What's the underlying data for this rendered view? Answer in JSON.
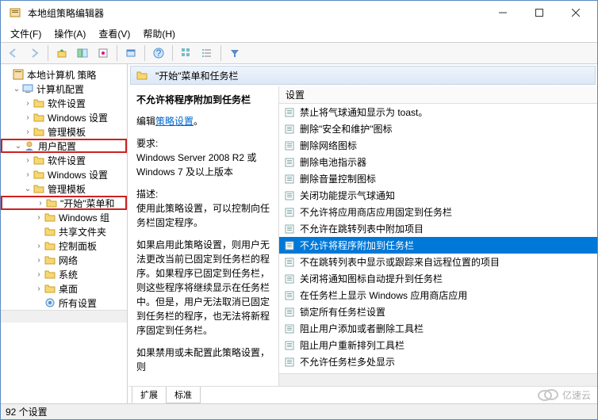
{
  "window": {
    "title": "本地组策略编辑器"
  },
  "menu": {
    "file": "文件(F)",
    "action": "操作(A)",
    "view": "查看(V)",
    "help": "帮助(H)"
  },
  "tree": {
    "root": "本地计算机 策略",
    "computer": "计算机配置",
    "user": "用户配置",
    "soft": "软件设置",
    "win": "Windows 设置",
    "admin": "管理模板",
    "start": "\"开始\"菜单和",
    "wincomp": "Windows 组",
    "share": "共享文件夹",
    "cpanel": "控制面板",
    "network": "网络",
    "system": "系统",
    "desktop": "桌面",
    "all": "所有设置"
  },
  "header": {
    "title": "\"开始\"菜单和任务栏"
  },
  "info": {
    "title": "不允许将程序附加到任务栏",
    "edit_prefix": "编辑",
    "edit_link": "策略设置",
    "req_label": "要求:",
    "req_text": "Windows Server 2008 R2 或 Windows 7 及以上版本",
    "desc_label": "描述:",
    "desc1": "使用此策略设置，可以控制向任务栏固定程序。",
    "desc2": "如果启用此策略设置，则用户无法更改当前已固定到任务栏的程序。如果程序已固定到任务栏，则这些程序将继续显示在任务栏中。但是，用户无法取消已固定到任务栏的程序，也无法将新程序固定到任务栏。",
    "desc3": "如果禁用或未配置此策略设置，则"
  },
  "listheader": "设置",
  "settings": [
    "禁止将气球通知显示为 toast。",
    "删除\"安全和维护\"图标",
    "删除网络图标",
    "删除电池指示器",
    "删除音量控制图标",
    "关闭功能提示气球通知",
    "不允许将应用商店应用固定到任务栏",
    "不允许在跳转列表中附加项目",
    "不允许将程序附加到任务栏",
    "不在跳转列表中显示或跟踪来自远程位置的项目",
    "关闭将通知图标自动提升到任务栏",
    "在任务栏上显示 Windows 应用商店应用",
    "锁定所有任务栏设置",
    "阻止用户添加或者删除工具栏",
    "阻止用户重新排列工具栏",
    "不允许任务栏多处显示"
  ],
  "selectedIndex": 8,
  "tabs": {
    "ext": "扩展",
    "std": "标准"
  },
  "status": "92 个设置",
  "watermark": "亿速云"
}
